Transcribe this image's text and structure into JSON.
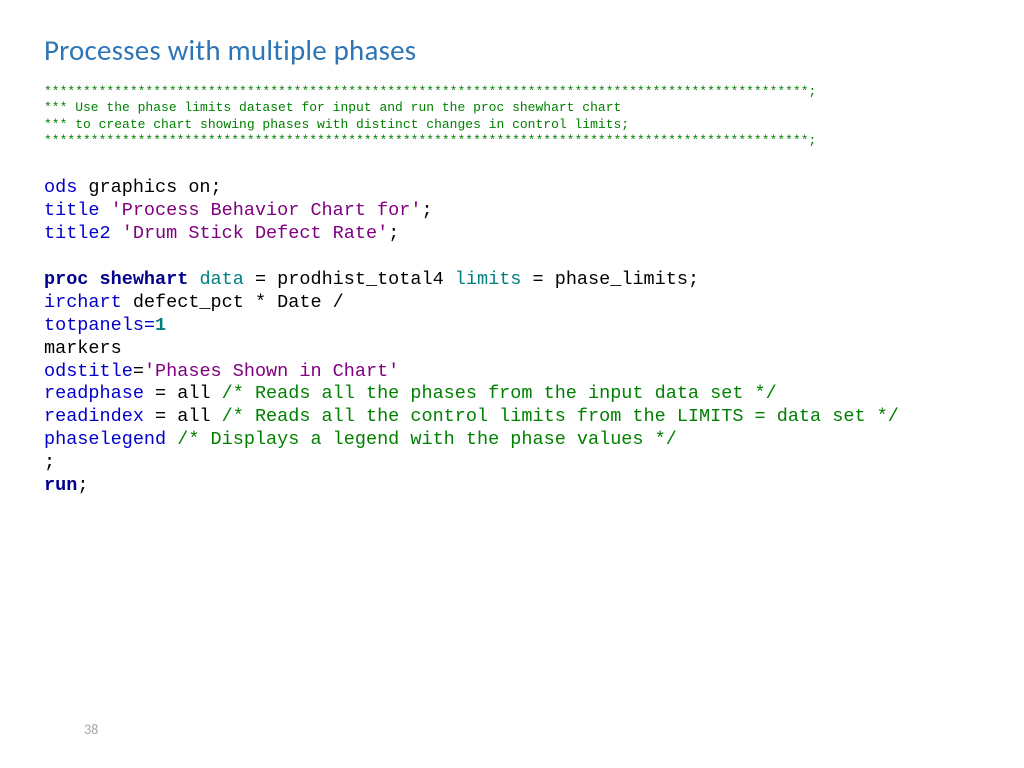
{
  "title": "Processes with multiple phases",
  "header_comment": {
    "rule": "**************************************************************************************************;",
    "line1": "*** Use the phase limits dataset for input and run the proc shewhart chart",
    "line2": "*** to create chart showing phases with distinct changes in control limits;",
    "rule2": "**************************************************************************************************;"
  },
  "code": {
    "ods": "ods",
    "graphics_on": " graphics on;",
    "title_kw": "title",
    "title_str": "'Process Behavior Chart for'",
    "title2_kw": "title2",
    "title2_str": "'Drum Stick Defect Rate'",
    "title2_tail": ";",
    "proc_shewhart": "proc shewhart",
    "data_kw": "data",
    "data_eq": " = prodhist_total4 ",
    "limits_kw": "limits",
    "limits_eq": " = phase_limits;",
    "irchart": "irchart",
    "irchart_rest": " defect_pct * Date /",
    "totpanels": "totpanels=",
    "one": "1",
    "markers": "markers",
    "odstitle": "odstitle",
    "odstitle_eq": "=",
    "odstitle_str": "'Phases Shown in Chart'",
    "readphase": "readphase",
    "readphase_eq": " = all ",
    "readphase_cmt": "/* Reads all the phases from the input data set */",
    "readindex": "readindex",
    "readindex_eq": " = all ",
    "readindex_cmt": "/* Reads all the control limits from the LIMITS = data set */",
    "phaselegend": "phaselegend",
    "phaselegend_sp": " ",
    "phaselegend_cmt": "/* Displays a legend with the phase values */",
    "semi": ";",
    "run": "run",
    "run_tail": ";"
  },
  "page_number": "38"
}
